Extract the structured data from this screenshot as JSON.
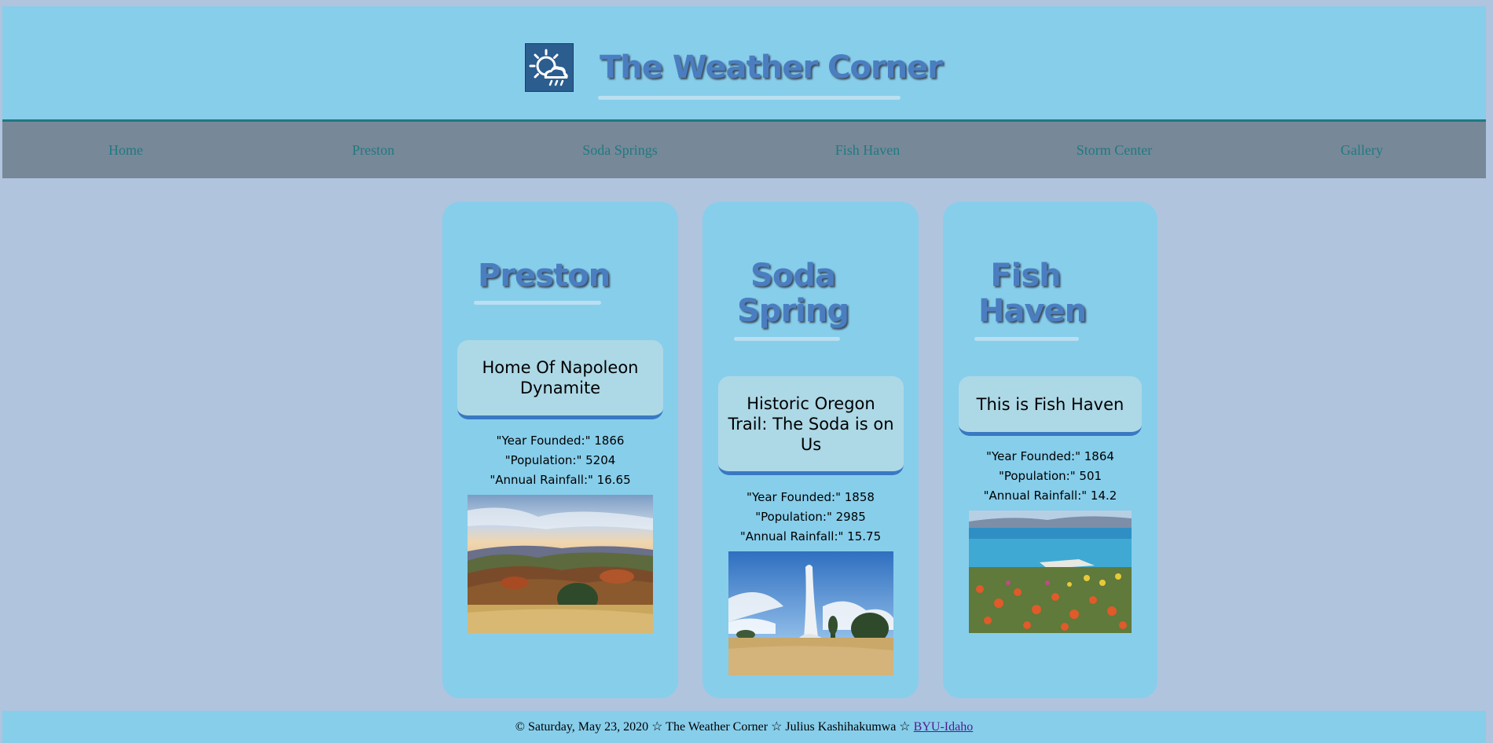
{
  "header": {
    "title": "The Weather Corner",
    "logo_icon": "weather-sun-cloud-icon"
  },
  "nav": {
    "items": [
      "Home",
      "Preston",
      "Soda Springs",
      "Fish Haven",
      "Storm Center",
      "Gallery"
    ]
  },
  "towns": [
    {
      "name": "Preston",
      "motto": "Home Of Napoleon Dynamite",
      "year_founded": "\"Year Founded:\" 1866",
      "population": "\"Population:\" 5204",
      "annual_rainfall": "\"Annual Rainfall:\" 16.65",
      "photo": "autumn-hills-photo"
    },
    {
      "name": "Soda Spring",
      "motto": "Historic Oregon Trail: The Soda is on Us",
      "year_founded": "\"Year Founded:\" 1858",
      "population": "\"Population:\" 2985",
      "annual_rainfall": "\"Annual Rainfall:\" 15.75",
      "photo": "geyser-photo"
    },
    {
      "name": "Fish Haven",
      "motto": "This is Fish Haven",
      "year_founded": "\"Year Founded:\" 1864",
      "population": "\"Population:\" 501",
      "annual_rainfall": "\"Annual Rainfall:\" 14.2",
      "photo": "lake-wildflowers-photo"
    }
  ],
  "footer": {
    "text": "© Saturday, May 23, 2020 ☆ The Weather Corner ☆ Julius Kashihakumwa ☆",
    "link": "BYU-Idaho"
  },
  "colors": {
    "page_bg": "#b0c4de",
    "header_bg": "#87ceeb",
    "nav_bg": "#778899",
    "nav_link": "#1f7a80",
    "heading": "#4a7ec0",
    "motto_bg": "#add8e6",
    "motto_border": "#3a78c2"
  }
}
